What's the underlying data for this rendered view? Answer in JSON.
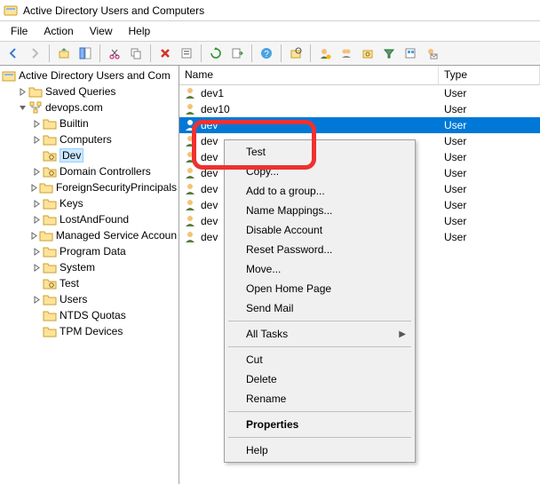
{
  "title": "Active Directory Users and Computers",
  "menu": {
    "items": [
      "File",
      "Action",
      "View",
      "Help"
    ]
  },
  "tree": {
    "root": "Active Directory Users and Com",
    "nodes": [
      {
        "label": "Saved Queries",
        "depth": 1,
        "tw": ">",
        "icon": "folder"
      },
      {
        "label": "devops.com",
        "depth": 1,
        "tw": "v",
        "icon": "domain"
      },
      {
        "label": "Builtin",
        "depth": 2,
        "tw": ">",
        "icon": "folder"
      },
      {
        "label": "Computers",
        "depth": 2,
        "tw": ">",
        "icon": "folder"
      },
      {
        "label": "Dev",
        "depth": 2,
        "tw": "",
        "icon": "ou",
        "selected": true
      },
      {
        "label": "Domain Controllers",
        "depth": 2,
        "tw": ">",
        "icon": "ou"
      },
      {
        "label": "ForeignSecurityPrincipals",
        "depth": 2,
        "tw": ">",
        "icon": "folder"
      },
      {
        "label": "Keys",
        "depth": 2,
        "tw": ">",
        "icon": "folder"
      },
      {
        "label": "LostAndFound",
        "depth": 2,
        "tw": ">",
        "icon": "folder"
      },
      {
        "label": "Managed Service Accoun",
        "depth": 2,
        "tw": ">",
        "icon": "folder"
      },
      {
        "label": "Program Data",
        "depth": 2,
        "tw": ">",
        "icon": "folder"
      },
      {
        "label": "System",
        "depth": 2,
        "tw": ">",
        "icon": "folder"
      },
      {
        "label": "Test",
        "depth": 2,
        "tw": "",
        "icon": "ou"
      },
      {
        "label": "Users",
        "depth": 2,
        "tw": ">",
        "icon": "folder"
      },
      {
        "label": "NTDS Quotas",
        "depth": 2,
        "tw": "",
        "icon": "folder"
      },
      {
        "label": "TPM Devices",
        "depth": 2,
        "tw": "",
        "icon": "folder"
      }
    ]
  },
  "list": {
    "cols": {
      "name": "Name",
      "type": "Type"
    },
    "rows": [
      {
        "name": "dev1",
        "type": "User"
      },
      {
        "name": "dev10",
        "type": "User"
      },
      {
        "name": "dev",
        "type": "User",
        "selected": true
      },
      {
        "name": "dev",
        "type": "User"
      },
      {
        "name": "dev",
        "type": "User"
      },
      {
        "name": "dev",
        "type": "User"
      },
      {
        "name": "dev",
        "type": "User"
      },
      {
        "name": "dev",
        "type": "User"
      },
      {
        "name": "dev",
        "type": "User"
      },
      {
        "name": "dev",
        "type": "User"
      }
    ]
  },
  "context_menu": {
    "items": [
      {
        "type": "item",
        "label": "Test"
      },
      {
        "type": "item",
        "label": "Copy..."
      },
      {
        "type": "item",
        "label": "Add to a group..."
      },
      {
        "type": "item",
        "label": "Name Mappings..."
      },
      {
        "type": "item",
        "label": "Disable Account"
      },
      {
        "type": "item",
        "label": "Reset Password..."
      },
      {
        "type": "item",
        "label": "Move..."
      },
      {
        "type": "item",
        "label": "Open Home Page"
      },
      {
        "type": "item",
        "label": "Send Mail"
      },
      {
        "type": "sep"
      },
      {
        "type": "item",
        "label": "All Tasks",
        "submenu": true
      },
      {
        "type": "sep"
      },
      {
        "type": "item",
        "label": "Cut"
      },
      {
        "type": "item",
        "label": "Delete"
      },
      {
        "type": "item",
        "label": "Rename"
      },
      {
        "type": "sep"
      },
      {
        "type": "item",
        "label": "Properties",
        "bold": true
      },
      {
        "type": "sep"
      },
      {
        "type": "item",
        "label": "Help"
      }
    ]
  },
  "toolbar_icons": [
    "back-arrow",
    "forward-arrow",
    "up-level",
    "show-hide-tree",
    "cut",
    "copy",
    "delete",
    "properties",
    "refresh",
    "export-list",
    "help",
    "find",
    "add-user",
    "add-group",
    "add-ou",
    "filter",
    "saved-queries",
    "mail"
  ]
}
